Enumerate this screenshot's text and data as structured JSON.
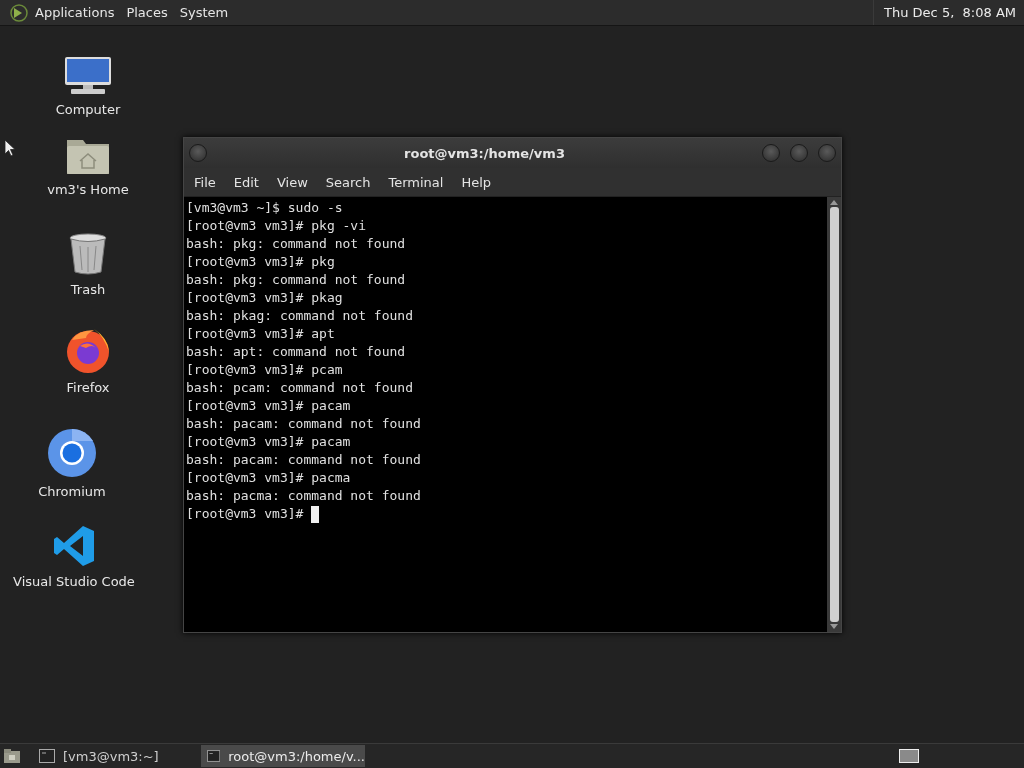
{
  "top_panel": {
    "menus": [
      "Applications",
      "Places",
      "System"
    ],
    "clock": "Thu Dec 5,  8:08 AM"
  },
  "desktop_icons": [
    {
      "label": "Computer",
      "kind": "computer"
    },
    {
      "label": "vm3's Home",
      "kind": "home"
    },
    {
      "label": "Trash",
      "kind": "trash"
    },
    {
      "label": "Firefox",
      "kind": "firefox"
    },
    {
      "label": "Chromium",
      "kind": "chromium"
    },
    {
      "label": "Visual Studio Code",
      "kind": "vscode"
    }
  ],
  "terminal_window": {
    "title": "root@vm3:/home/vm3",
    "menu": [
      "File",
      "Edit",
      "View",
      "Search",
      "Terminal",
      "Help"
    ],
    "lines": [
      "[vm3@vm3 ~]$ sudo -s",
      "[root@vm3 vm3]# pkg -vi",
      "bash: pkg: command not found",
      "[root@vm3 vm3]# pkg",
      "bash: pkg: command not found",
      "[root@vm3 vm3]# pkag",
      "bash: pkag: command not found",
      "[root@vm3 vm3]# apt",
      "bash: apt: command not found",
      "[root@vm3 vm3]# pcam",
      "bash: pcam: command not found",
      "[root@vm3 vm3]# pacam",
      "bash: pacam: command not found",
      "[root@vm3 vm3]# pacam",
      "bash: pacam: command not found",
      "[root@vm3 vm3]# pacma",
      "bash: pacma: command not found"
    ],
    "prompt": "[root@vm3 vm3]#"
  },
  "taskbar": {
    "tasks": [
      {
        "label": "[vm3@vm3:~]",
        "selected": false
      },
      {
        "label": "root@vm3:/home/v...",
        "selected": true
      }
    ]
  }
}
